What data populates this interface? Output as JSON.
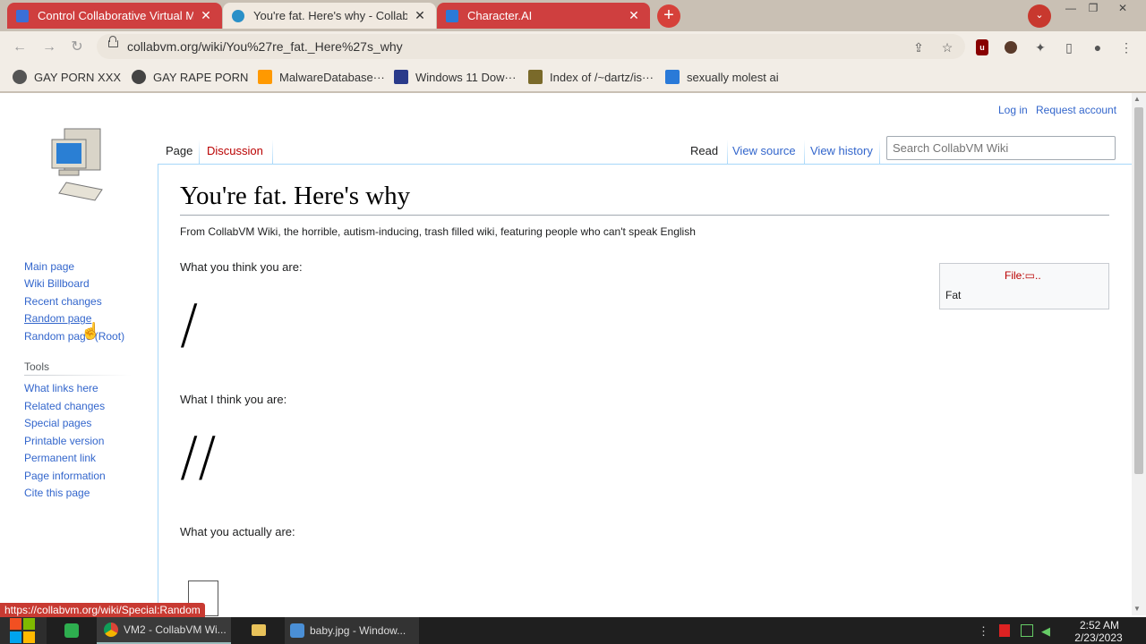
{
  "browser": {
    "tabs": [
      {
        "title": "Control Collaborative Virtual Machines",
        "favicon_color": "#3a6fd8"
      },
      {
        "title": "You're fat. Here's why - CollabVM Wiki",
        "favicon_color": "#2a90c8"
      },
      {
        "title": "Character.AI",
        "favicon_color": "#2a7ad8"
      }
    ],
    "new_tab": "+",
    "tab_search": "⌄",
    "url": "collabvm.org/wiki/You%27re_fat._Here%27s_why",
    "bookmarks": [
      {
        "label": "GAY PORN XXX"
      },
      {
        "label": "GAY RAPE PORN"
      },
      {
        "label": "MalwareDatabase···"
      },
      {
        "label": "Windows 11 Dow···"
      },
      {
        "label": "Index of /~dartz/is···"
      },
      {
        "label": "sexually molest ai"
      }
    ],
    "status_url": "https://collabvm.org/wiki/Special:Random"
  },
  "wiki": {
    "personal": {
      "login": "Log in",
      "request": "Request account"
    },
    "tabs": {
      "page": "Page",
      "discussion": "Discussion",
      "read": "Read",
      "view_source": "View source",
      "view_history": "View history"
    },
    "search_placeholder": "Search CollabVM Wiki",
    "title": "You're fat. Here's why",
    "tagline": "From CollabVM Wiki, the horrible, autism-inducing, trash filled wiki, featuring people who can't speak English",
    "body": {
      "line1": "What you think you are:",
      "glyph1": "/",
      "line2": "What I think you are:",
      "glyph2": "//",
      "line3": "What you actually are:"
    },
    "filebox": {
      "link": "File:▭..",
      "caption": "Fat"
    },
    "navigation": [
      "Main page",
      "Wiki Billboard",
      "Recent changes",
      "Random page",
      "Random page (Root)"
    ],
    "tools_heading": "Tools",
    "tools": [
      "What links here",
      "Related changes",
      "Special pages",
      "Printable version",
      "Permanent link",
      "Page information",
      "Cite this page"
    ]
  },
  "taskbar": {
    "chrome_label": "VM2 - CollabVM Wi...",
    "photos_label": "baby.jpg - Window...",
    "time": "2:52 AM",
    "date": "2/23/2023"
  }
}
